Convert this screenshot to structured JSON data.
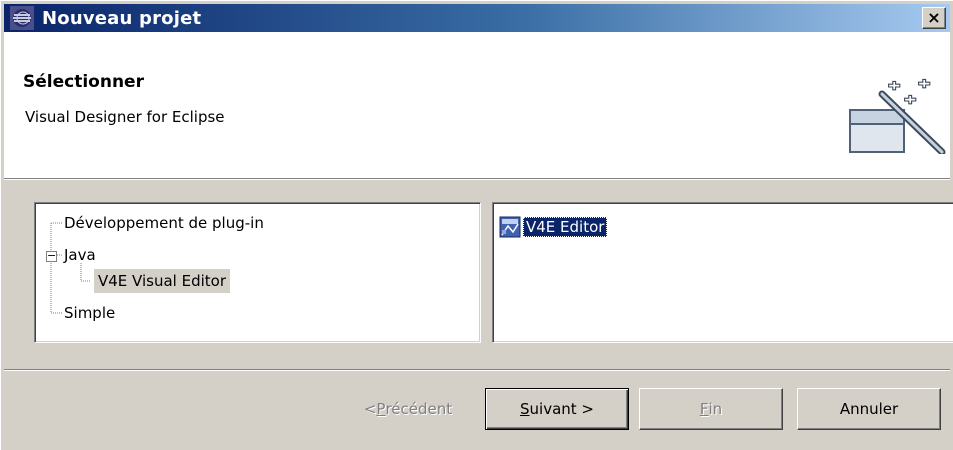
{
  "window": {
    "title": "Nouveau projet",
    "close_label": "×",
    "icon": "eclipse-icon"
  },
  "header": {
    "title": "Sélectionner",
    "description": "Visual Designer for Eclipse",
    "icon": "new-wizard-icon"
  },
  "tree": {
    "items": [
      {
        "label": "Développement de plug-in"
      },
      {
        "label": "Java",
        "expanded": true
      },
      {
        "label": "V4E Visual Editor",
        "selected": true
      },
      {
        "label": "Simple"
      }
    ],
    "expander_symbol": "−"
  },
  "list": {
    "items": [
      {
        "label": "V4E Editor",
        "icon": "editor-icon",
        "selected": true
      }
    ]
  },
  "buttons": {
    "prev": {
      "prefix": "< ",
      "mnemonic": "P",
      "rest": "récédent",
      "enabled": false
    },
    "next": {
      "prefix": "",
      "mnemonic": "S",
      "rest": "uivant >",
      "enabled": true
    },
    "finish": {
      "prefix": "",
      "mnemonic": "F",
      "rest": "in",
      "enabled": false
    },
    "cancel": {
      "label": "Annuler",
      "enabled": true
    }
  },
  "colors": {
    "titlebar_start": "#0a246a",
    "titlebar_end": "#a6caf0",
    "selection": "#0a246a",
    "face": "#d4d0c8"
  }
}
